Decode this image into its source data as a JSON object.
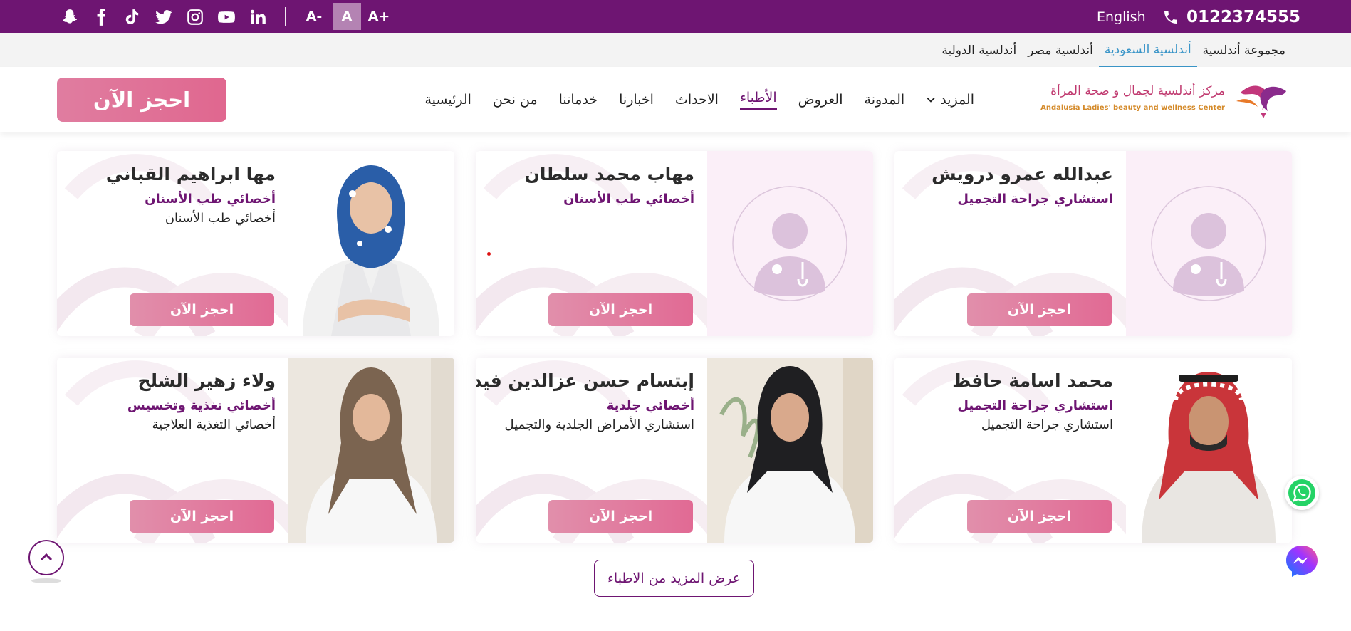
{
  "topbar": {
    "social_icons": [
      "snapchat-icon",
      "facebook-icon",
      "tiktok-icon",
      "twitter-icon",
      "instagram-icon",
      "youtube-icon",
      "linkedin-icon"
    ],
    "font_decrease": "A-",
    "font_normal": "A",
    "font_increase": "A+",
    "language": "English",
    "phone": "0122374555"
  },
  "branches": [
    {
      "label": "مجموعة أندلسية",
      "active": false
    },
    {
      "label": "أندلسية السعودية",
      "active": true
    },
    {
      "label": "أندلسية مصر",
      "active": false
    },
    {
      "label": "أندلسية الدولية",
      "active": false
    }
  ],
  "logo": {
    "arabic": "مركز أندلسية لجمال و صحة المرأة",
    "english": "Andalusia Ladies' beauty and wellness Center"
  },
  "nav": {
    "items": [
      {
        "label": "الرئيسية"
      },
      {
        "label": "من نحن"
      },
      {
        "label": "خدماتنا"
      },
      {
        "label": "اخبارنا"
      },
      {
        "label": "الاحداث"
      },
      {
        "label": "الأطباء"
      },
      {
        "label": "العروض"
      },
      {
        "label": "المدونة"
      },
      {
        "label": "المزيد"
      }
    ],
    "book_label": "احجز الآن"
  },
  "doctors": [
    {
      "name": "عبدالله عمرو درويش",
      "title": "استشاري جراحة التجميل",
      "desc": "",
      "photo": "placeholder-avatar",
      "book": "احجز الآن"
    },
    {
      "name": "مهاب محمد سلطان",
      "title": "أخصائي طب الأسنان",
      "desc": "",
      "photo": "placeholder-avatar",
      "book": "احجز الآن"
    },
    {
      "name": "مها ابراهيم القباني",
      "title": "أخصائي طب الأسنان",
      "desc": "أخصائي طب الأسنان",
      "photo": "doctor-photo",
      "book": "احجز الآن"
    },
    {
      "name": "محمد اسامة حافظ",
      "title": "استشاري جراحة التجميل",
      "desc": "استشاري جراحة التجميل",
      "photo": "doctor-photo",
      "book": "احجز الآن"
    },
    {
      "name": "إبتسام حسن عزالدين فيده",
      "title": "أخصائي جلدية",
      "desc": "استشاري الأمراض الجلدية والتجميل",
      "photo": "doctor-photo",
      "book": "احجز الآن"
    },
    {
      "name": "ولاء زهير الشلح",
      "title": "أخصائي تغذية وتخسيس",
      "desc": "أخصائي التغذية العلاجية",
      "photo": "doctor-photo",
      "book": "احجز الآن"
    }
  ],
  "more_doctors": "عرض المزيد من الاطباء",
  "colors": {
    "brand": "#6e1572",
    "button": "#e0678f",
    "branch_active": "#3a95c8"
  }
}
